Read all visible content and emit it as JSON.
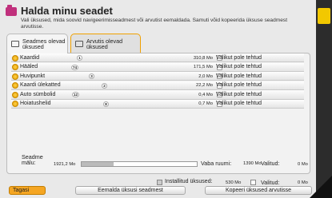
{
  "header": {
    "title": "Halda minu seadet",
    "subtitle": "Vali üksused, mida soovid navigeerimisseadmest või arvutist eemaldada. Samuti võid kopeerida üksuse seadmest arvutisse."
  },
  "tabs": [
    {
      "label": "Seadmes olevad üksused",
      "active": true
    },
    {
      "label": "Arvutis olevad üksused",
      "active": false
    }
  ],
  "items": [
    {
      "name": "Kaardid",
      "count": "1",
      "size": "310,8 Mo",
      "status": "Valikut pole tehtud"
    },
    {
      "name": "Hääled",
      "count": "74",
      "size": "171,5 Mo",
      "status": "Valikut pole tehtud"
    },
    {
      "name": "Huvipunkt",
      "count": "3",
      "size": "2,0 Mo",
      "status": "Valikut pole tehtud"
    },
    {
      "name": "Kaardi ülekatted",
      "count": "2",
      "size": "22,2 Mo",
      "status": "Valikut pole tehtud"
    },
    {
      "name": "Auto sümbolid",
      "count": "12",
      "size": "0,4 Mo",
      "status": "Valikut pole tehtud"
    },
    {
      "name": "Hoiatushelid",
      "count": "8",
      "size": "0,7 Mo",
      "status": "Valikut pole tehtud"
    }
  ],
  "memory": {
    "label": "Seadme mälu:",
    "total": "1921,2 Mo",
    "used_fraction": 0.28,
    "free_label": "Vaba ruumi:",
    "free_value": "1390 Mo",
    "selected_label": "Valitud:",
    "selected_value": "0 Mo"
  },
  "installed": {
    "label": "Installitud üksused:",
    "value": "530 Mo",
    "selected_label": "Valitud:",
    "selected_value": "0 Mo"
  },
  "buttons": {
    "back": "Tagasi",
    "remove": "Eemalda üksusi seadmest",
    "copy": "Kopeeri üksused arvutisse"
  },
  "colors": {
    "accent": "#f5a623",
    "title_icon": "#c0307c",
    "logo": "#f2c800"
  }
}
